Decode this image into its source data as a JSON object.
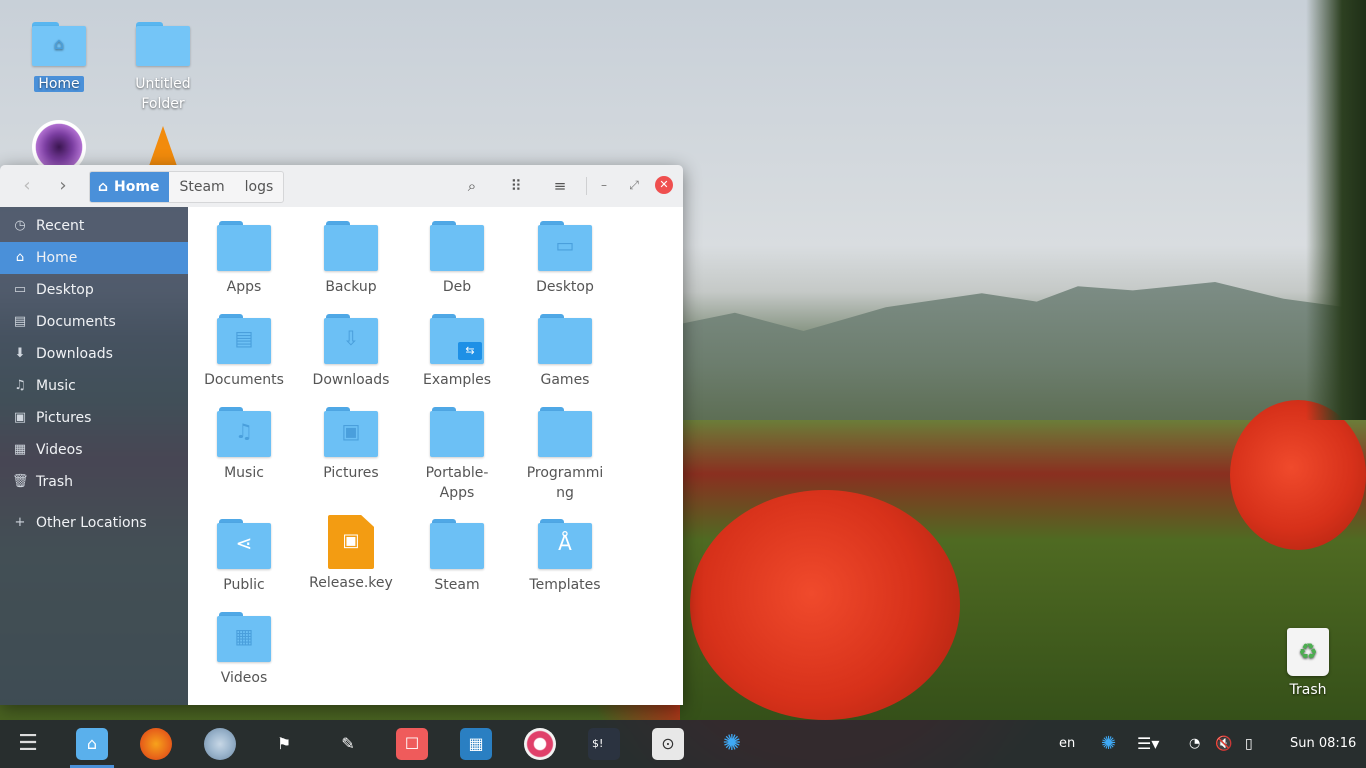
{
  "desktop": {
    "icons": [
      {
        "label": "Home",
        "icon": "home-folder-icon"
      },
      {
        "label": "Untitled Folder",
        "icon": "folder-icon"
      },
      {
        "label": "",
        "icon": "app-icon-purple-lens"
      },
      {
        "label": "",
        "icon": "vlc-icon"
      }
    ],
    "trash_label": "Trash"
  },
  "window": {
    "breadcrumbs": [
      "Home",
      "Steam",
      "logs"
    ],
    "sidebar": [
      {
        "label": "Recent",
        "icon": "clock-icon"
      },
      {
        "label": "Home",
        "icon": "home-icon",
        "active": true
      },
      {
        "label": "Desktop",
        "icon": "desktop-icon"
      },
      {
        "label": "Documents",
        "icon": "documents-icon"
      },
      {
        "label": "Downloads",
        "icon": "download-icon"
      },
      {
        "label": "Music",
        "icon": "music-icon"
      },
      {
        "label": "Pictures",
        "icon": "pictures-icon"
      },
      {
        "label": "Videos",
        "icon": "videos-icon"
      },
      {
        "label": "Trash",
        "icon": "trash-icon"
      },
      {
        "label": "Other Locations",
        "icon": "plus-icon"
      }
    ],
    "items": [
      {
        "label": "Apps",
        "type": "folder"
      },
      {
        "label": "Backup",
        "type": "folder"
      },
      {
        "label": "Deb",
        "type": "folder"
      },
      {
        "label": "Desktop",
        "type": "folder"
      },
      {
        "label": "Documents",
        "type": "folder"
      },
      {
        "label": "Downloads",
        "type": "folder"
      },
      {
        "label": "Examples",
        "type": "folder"
      },
      {
        "label": "Games",
        "type": "folder"
      },
      {
        "label": "Music",
        "type": "folder"
      },
      {
        "label": "Pictures",
        "type": "folder"
      },
      {
        "label": "Portable-Apps",
        "type": "folder"
      },
      {
        "label": "Programming",
        "type": "folder"
      },
      {
        "label": "Public",
        "type": "folder"
      },
      {
        "label": "Release.key",
        "type": "file"
      },
      {
        "label": "Steam",
        "type": "folder"
      },
      {
        "label": "Templates",
        "type": "folder"
      },
      {
        "label": "Videos",
        "type": "folder"
      }
    ]
  },
  "taskbar": {
    "language": "en",
    "clock": "Sun 08:16"
  }
}
